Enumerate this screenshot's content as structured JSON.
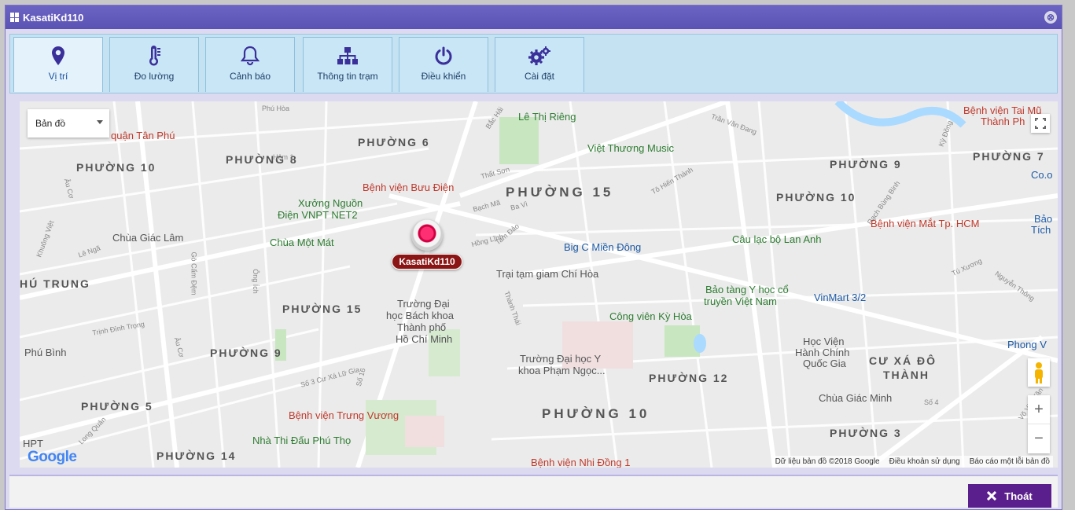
{
  "window": {
    "title": "KasatiKd110",
    "close_glyph": "⊗"
  },
  "tabs": [
    {
      "label": "Vị trí",
      "icon": "location-pin-icon",
      "active": true
    },
    {
      "label": "Đo lường",
      "icon": "thermometer-icon",
      "active": false
    },
    {
      "label": "Cảnh báo",
      "icon": "bell-icon",
      "active": false
    },
    {
      "label": "Thông tin trạm",
      "icon": "sitemap-icon",
      "active": false
    },
    {
      "label": "Điều khiển",
      "icon": "power-icon",
      "active": false
    },
    {
      "label": "Cài đặt",
      "icon": "gears-icon",
      "active": false
    }
  ],
  "map": {
    "type_selector": "Bản đồ",
    "marker_label": "KasatiKd110",
    "zoom_in": "+",
    "zoom_out": "−",
    "google_logo": "Google",
    "attribution": {
      "data": "Dữ liệu bản đồ ©2018 Google",
      "terms": "Điều khoản sử dụng",
      "report": "Báo cáo một lỗi bản đồ"
    },
    "labels": {
      "phuong_6": "PHƯỜNG 6",
      "phuong_8": "PHƯỜNG 8",
      "phuong_10_left": "PHƯỜNG 10",
      "phuong_15_center": "PHƯỜNG 15",
      "phuong_10_right": "PHƯỜNG 10",
      "phuong_9_right": "PHƯỜNG 9",
      "phuong_7": "PHƯỜNG 7",
      "phu_trung": "HÚ TRUNG",
      "phuong_15_left": "PHƯỜNG 15",
      "phuong_9_left": "PHƯỜNG 9",
      "phuong_5": "PHƯỜNG 5",
      "phuong_14": "PHƯỜNG 14",
      "phuong_12": "PHƯỜNG 12",
      "phuong_10_bottom": "PHƯỜNG 10",
      "phuong_3": "PHƯỜNG 3",
      "cu_xa_do_thanh_1": "CƯ XÁ ĐÔ",
      "cu_xa_do_thanh_2": "THÀNH",
      "quan_tan_phu": "quận Tân Phú",
      "benh_vien_buu_dien": "Bệnh viện Bưu Điện",
      "xuong_nguon_1": "Xưởng Nguồn",
      "xuong_nguon_2": "Điện VNPT NET2",
      "chua_mot_mat": "Chùa Một Mát",
      "chua_giac_lam": "Chùa Giác Lâm",
      "cong_vien_le_thi_rieng": "Lê Thị Riêng",
      "viet_thuong_music": "Việt Thương Music",
      "big_c": "Big C Miền Đông",
      "trai_tam_giam": "Trại tạm giam Chí Hòa",
      "cau_lac_bo": "Câu lạc bộ Lan Anh",
      "benh_vien_mat": "Bệnh viện Mắt Tp. HCM",
      "bao_tich": "Bảo",
      "bao_tich_2": "Tích",
      "bao_tang_1": "Bảo tàng Y học cổ",
      "bao_tang_2": "truyền Việt Nam",
      "vinmart": "VinMart 3/2",
      "truong_bk_1": "Trường Đại",
      "truong_bk_2": "học Bách khoa",
      "truong_bk_3": "Thành phố",
      "truong_bk_4": "Hồ Chí Minh",
      "cong_vien_ky_hoa": "Công viên Kỳ Hòa",
      "truong_y_1": "Trường Đại học Y",
      "truong_y_2": "khoa Phạm Ngọc...",
      "hoc_vien_1": "Học Viện",
      "hoc_vien_2": "Hành Chính",
      "hoc_vien_3": "Quốc Gia",
      "phong_v": "Phong V",
      "phu_binh": "Phú Bình",
      "benh_vien_trung_vuong": "Bệnh viện Trưng Vương",
      "chua_giac_minh": "Chùa Giác Minh",
      "nha_thi_dau": "Nhà Thi Đấu Phú Thọ",
      "benh_vien_nhi_dong": "Bệnh viện Nhi Đồng 1",
      "benh_vien_tai_mui_1": "Bệnh viện Tai Mũ",
      "benh_vien_tai_mui_2": "Thành Ph",
      "co_o": "Co.o",
      "hpt": "HPT",
      "thanh_thai": "Thành Thái",
      "to_hien_thanh": "Tô Hiến Thành",
      "au_co_1": "Âu Cơ",
      "au_co_2": "Âu Cơ",
      "trinh_dinh_trong": "Trịnh Đình Trọng",
      "bac_hai": "Bắc Hải",
      "long_quan": "Long Quân",
      "cu_xa_lu_gia": "Số 3 Cư Xá Lữ Gia",
      "hem_1": "Hẻm 1",
      "le_nga": "Lê Ngã",
      "khuong_viet": "Khuông Việt",
      "go_cam_dem": "Gò Cẩm Đệm",
      "ong_ich": "Ông Ích",
      "phu_hoa": "Phú Hòa",
      "that_son": "Thất Sơn",
      "bach_ma": "Bạch Mã",
      "ba_vi": "Ba Vì",
      "hong_linh": "Hồng Lĩnh",
      "tam_dao": "Tam Đảo",
      "tran_van_dang": "Trần Văn Đang",
      "rach_bung_binh": "Rạch Bùng Binh",
      "ky_dong": "Kỳ Đồng",
      "tu_xuong": "Tú Xương",
      "nguyen_thong": "Nguyễn Thông",
      "vo_van_tan": "Võ Văn Tần",
      "so_4": "Số 4",
      "lu_gia_16": "Số 16"
    }
  },
  "footer": {
    "exit_label": "Thoát"
  },
  "colors": {
    "accent": "#5a53b4",
    "exit_button": "#5a1f8c",
    "marker": "#8b1414"
  }
}
